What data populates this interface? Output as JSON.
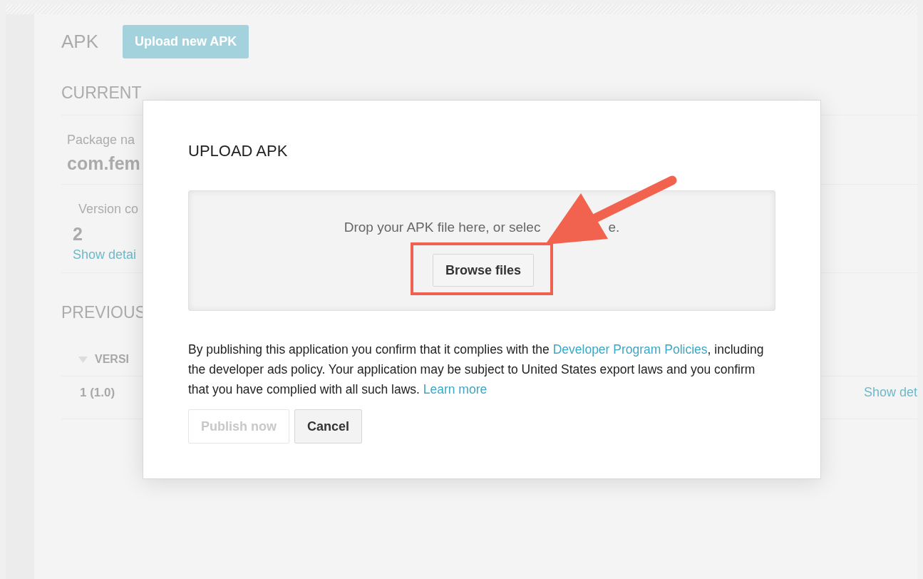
{
  "background": {
    "title": "APK",
    "upload_button": {
      "label": "Upload new APK",
      "disabled": true
    },
    "current_heading": "CURRENT",
    "package_label": "Package na",
    "package_value": "com.fem",
    "version_label": "Version co",
    "version_value": "2",
    "show_details_link": "Show detai",
    "previous_heading": "PREVIOUS",
    "table": {
      "column_header": "VERSI",
      "rows": [
        {
          "column_1": "1 (1.0)",
          "link": "Show det"
        }
      ]
    }
  },
  "dialog": {
    "title": "UPLOAD APK",
    "drop_zone": {
      "text_visible": "Drop your APK file here, or selec",
      "text_tail": "e.",
      "browse_button": "Browse files"
    },
    "notice": [
      {
        "kind": "text",
        "text": "By publishing this application you confirm that it complies with the "
      },
      {
        "kind": "link",
        "text": "Developer Program Policies"
      },
      {
        "kind": "text",
        "text": ", including the developer ads policy. Your application may be subject to United States export laws and you confirm that you have complied with all such laws. "
      },
      {
        "kind": "link",
        "text": "Learn more"
      }
    ],
    "buttons": [
      {
        "label": "Publish now",
        "disabled": true
      },
      {
        "label": "Cancel",
        "disabled": false
      }
    ]
  }
}
